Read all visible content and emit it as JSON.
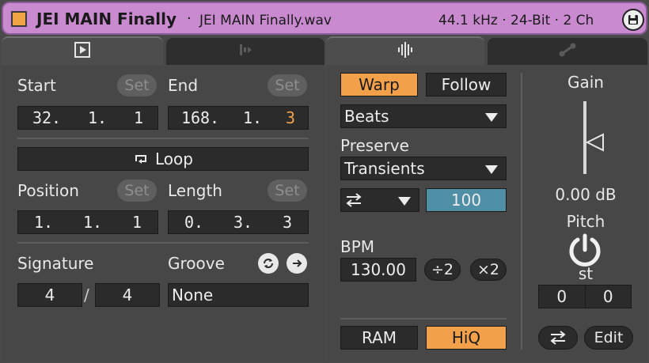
{
  "titlebar": {
    "clip_name": "JEI MAIN Finally",
    "separator": "·",
    "file_name": "JEI MAIN Finally.wav",
    "file_info": "44.1 kHz · 24-Bit · 2 Ch",
    "clip_color": "#f0a446",
    "bar_color": "#c98ad0"
  },
  "left_panel": {
    "tabs": [
      {
        "icon": "play-icon",
        "active": true
      },
      {
        "icon": "waveform-bars-icon",
        "active": false
      }
    ],
    "start": {
      "label": "Start",
      "set_label": "Set",
      "value": [
        "32.",
        "1.",
        "1"
      ]
    },
    "end": {
      "label": "End",
      "set_label": "Set",
      "value": [
        "168.",
        "1.",
        "3"
      ]
    },
    "loop_label": "Loop",
    "position": {
      "label": "Position",
      "set_label": "Set",
      "value": [
        "1.",
        "1.",
        "1"
      ]
    },
    "length": {
      "label": "Length",
      "set_label": "Set",
      "value": [
        "0.",
        "3.",
        "3"
      ]
    },
    "signature": {
      "label": "Signature",
      "numerator": "4",
      "slash": "/",
      "denominator": "4"
    },
    "groove": {
      "label": "Groove",
      "value": "None"
    }
  },
  "right_panel": {
    "tabs": [
      {
        "icon": "waveform-icon",
        "active": true
      },
      {
        "icon": "envelope-icon",
        "active": false
      }
    ],
    "warp_label": "Warp",
    "follow_label": "Follow",
    "warp_mode": "Beats",
    "preserve_label": "Preserve",
    "preserve_value": "Transients",
    "loop_mode_icon": "swap-arrows-icon",
    "envelope_value": "100",
    "bpm_label": "BPM",
    "bpm_value": "130.00",
    "halve_label": "÷2",
    "double_label": "×2",
    "ram_label": "RAM",
    "hiq_label": "HiQ",
    "gain_label": "Gain",
    "gain_value": "0.00 dB",
    "gain_level": 0.0,
    "pitch_label": "Pitch",
    "pitch_unit": "st",
    "pitch_coarse": "0",
    "pitch_fine": "0",
    "edit_label": "Edit",
    "colors": {
      "accent_orange": "#f2a04a",
      "accent_blue": "#4f8fa6"
    }
  }
}
